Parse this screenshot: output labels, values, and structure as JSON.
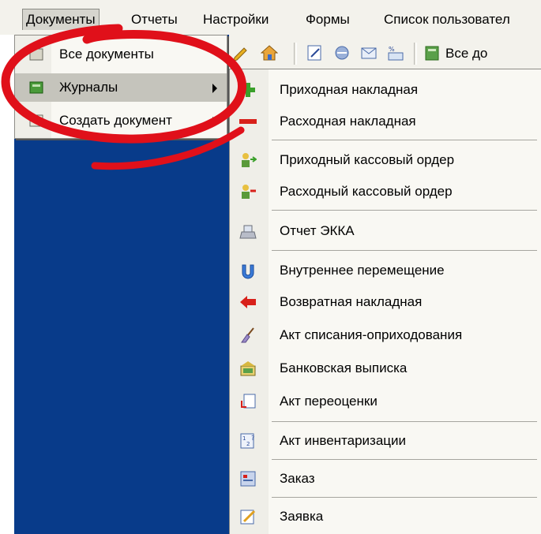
{
  "menubar": {
    "items": [
      "Документы",
      "Отчеты",
      "Настройки",
      "Формы",
      "Список пользовател"
    ]
  },
  "toolbar": {
    "text": "Все до"
  },
  "menu": {
    "items": [
      {
        "label": "Все документы",
        "icon": "document-icon",
        "submenu": false
      },
      {
        "label": "Журналы",
        "icon": "journal-icon",
        "submenu": true,
        "highlighted": true
      },
      {
        "label": "Создать документ",
        "icon": "new-document-icon",
        "submenu": true
      }
    ]
  },
  "submenu": {
    "items": [
      {
        "label": "Приходная накладная",
        "icon": "plus-icon"
      },
      {
        "label": "Расходная накладная",
        "icon": "minus-icon"
      },
      {
        "label": "Приходный кассовый ордер",
        "icon": "person-in-icon"
      },
      {
        "label": "Расходный кассовый ордер",
        "icon": "person-out-icon"
      },
      {
        "label": "Отчет ЭККА",
        "icon": "cash-register-icon"
      },
      {
        "label": "Внутреннее перемещение",
        "icon": "move-icon"
      },
      {
        "label": "Возвратная накладная",
        "icon": "return-arrow-icon"
      },
      {
        "label": "Акт списания-оприходования",
        "icon": "broom-icon"
      },
      {
        "label": "Банковская выписка",
        "icon": "bank-icon"
      },
      {
        "label": "Акт переоценки",
        "icon": "revaluation-icon"
      },
      {
        "label": "Акт инвентаризации",
        "icon": "inventory-icon"
      },
      {
        "label": "Заказ",
        "icon": "order-icon"
      },
      {
        "label": "Заявка",
        "icon": "request-icon"
      }
    ]
  },
  "colors": {
    "workspace": "#083b8a",
    "menu_bg": "#f9f8f3",
    "highlight": "#c5c4bc",
    "annotation": "#e0101a"
  }
}
